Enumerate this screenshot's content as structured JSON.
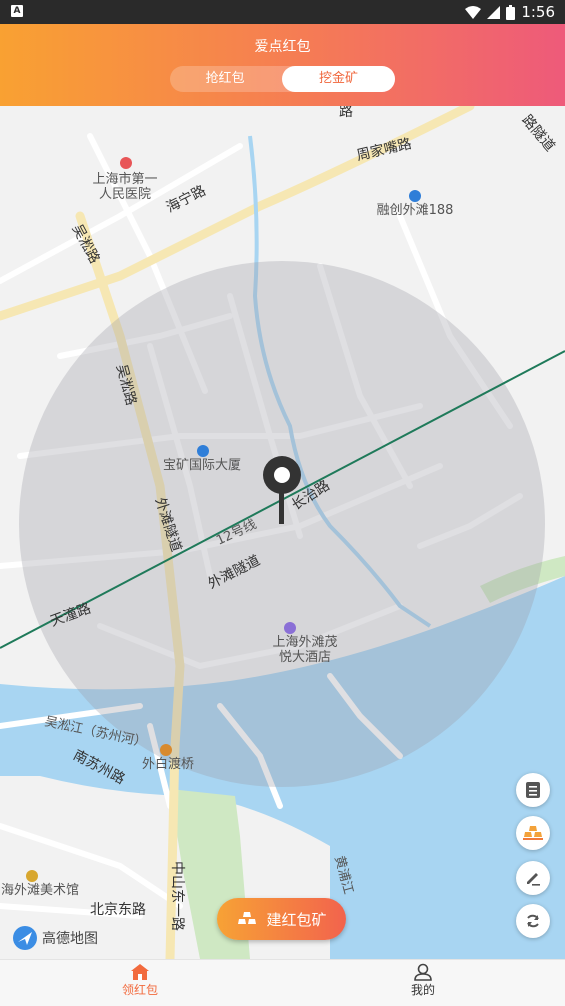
{
  "status_bar": {
    "time": "1:56",
    "app_icon": "A"
  },
  "header": {
    "title": "爱点红包",
    "tabs": [
      {
        "label": "抢红包",
        "active": false
      },
      {
        "label": "挖金矿",
        "active": true
      }
    ]
  },
  "map": {
    "labels": {
      "hospital": [
        "上海市第一",
        "人民医院"
      ],
      "ronchuang": "融创外滩188",
      "zhoujiazui": "周家嘴路",
      "haining": "海宁路",
      "wusong_top": "吴淞路",
      "wusong_mid": "吴淞路",
      "baokuang": "宝矿国际大厦",
      "waitan_tunnel_v": "外滩隧道",
      "waitan_tunnel": "外滩隧道",
      "changzhi": "长治路",
      "line12": "12号线",
      "tiantong": "天潼路",
      "hotel": [
        "上海外滩茂",
        "悦大酒店"
      ],
      "suzhou_creek": "吴淞江（苏州河）",
      "nansuzhou": "南苏州路",
      "waibaidu": "外白渡桥",
      "art_museum": "海外滩美术馆",
      "beijing_east": "北京东路",
      "zhongshan": "中山东一路",
      "huangpu": "黄浦江",
      "top_road": "路",
      "tunnel_right": "路隧道"
    },
    "logo_text": "高德地图"
  },
  "map_controls": [
    "document-icon",
    "gold-icon",
    "edit-icon",
    "refresh-icon"
  ],
  "build_button": {
    "label": "建红包矿"
  },
  "bottom_nav": [
    {
      "label": "领红包",
      "active": true
    },
    {
      "label": "我的",
      "active": false
    }
  ],
  "colors": {
    "accent": "#f26a3d",
    "gradient_start": "#f9a132",
    "gradient_end": "#ee5a7a",
    "metro_line": "#1f7a5a",
    "water": "#a8d5f2"
  }
}
